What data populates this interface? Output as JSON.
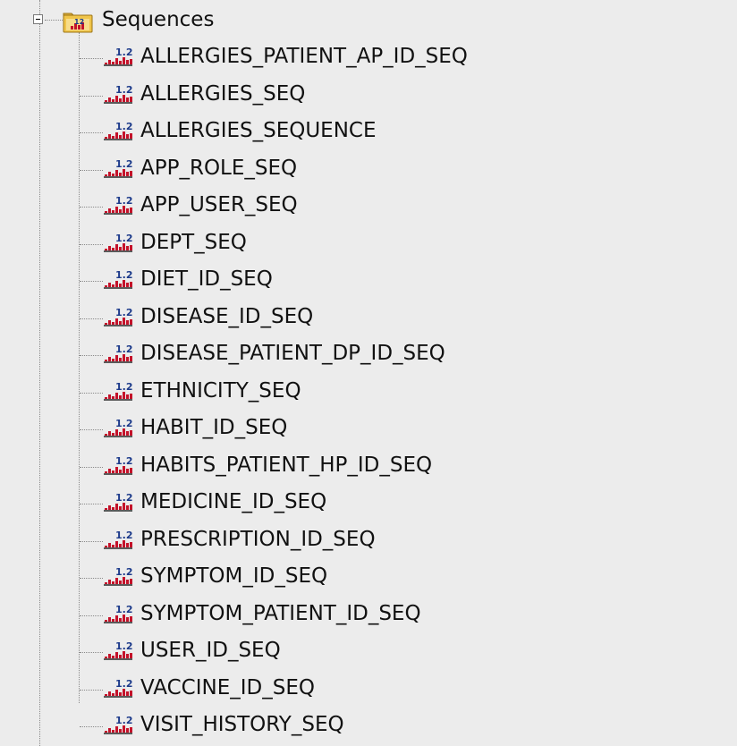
{
  "tree": {
    "folder": {
      "label": "Sequences",
      "icon": "sequence-folder-icon",
      "icon_digits": "12",
      "expanded": true
    },
    "item_icon": {
      "name": "sequence-icon",
      "digits": "1.2",
      "accent_color": "#c4122a"
    },
    "items": [
      {
        "label": "ALLERGIES_PATIENT_AP_ID_SEQ"
      },
      {
        "label": "ALLERGIES_SEQ"
      },
      {
        "label": "ALLERGIES_SEQUENCE"
      },
      {
        "label": "APP_ROLE_SEQ"
      },
      {
        "label": "APP_USER_SEQ"
      },
      {
        "label": "DEPT_SEQ"
      },
      {
        "label": "DIET_ID_SEQ"
      },
      {
        "label": "DISEASE_ID_SEQ"
      },
      {
        "label": "DISEASE_PATIENT_DP_ID_SEQ"
      },
      {
        "label": "ETHNICITY_SEQ"
      },
      {
        "label": "HABIT_ID_SEQ"
      },
      {
        "label": "HABITS_PATIENT_HP_ID_SEQ"
      },
      {
        "label": "MEDICINE_ID_SEQ"
      },
      {
        "label": "PRESCRIPTION_ID_SEQ"
      },
      {
        "label": "SYMPTOM_ID_SEQ"
      },
      {
        "label": "SYMPTOM_PATIENT_ID_SEQ"
      },
      {
        "label": "USER_ID_SEQ"
      },
      {
        "label": "VACCINE_ID_SEQ"
      },
      {
        "label": "VISIT_HISTORY_SEQ"
      }
    ]
  }
}
